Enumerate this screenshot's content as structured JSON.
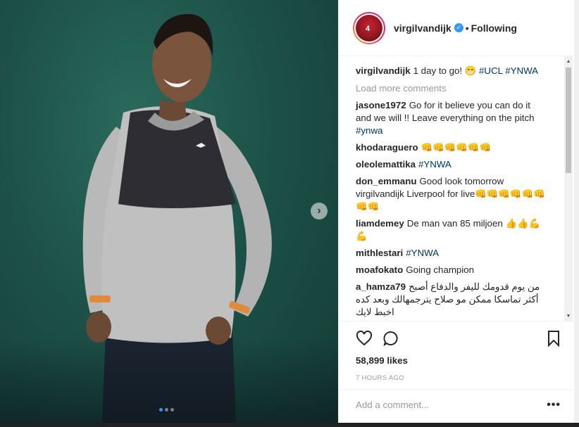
{
  "post": {
    "username": "virgilvandijk",
    "follow_status": "Following",
    "likes": "58,899 likes",
    "time": "7 HOURS AGO",
    "load_more": "Load more comments",
    "add_comment_placeholder": "Add a comment...",
    "carousel": {
      "count": 3,
      "active_index": 0
    }
  },
  "caption": {
    "user": "virgilvandijk",
    "text": "1 day to go! 😁 ",
    "tags": "#UCL #YNWA"
  },
  "comments": [
    {
      "user": "jasone1972",
      "text": "Go for it believe you can do it and we will !! Leave everything on the pitch ",
      "tag": "#ynwa"
    },
    {
      "user": "khodaraguero",
      "text": "👊👊👊👊👊👊",
      "tag": ""
    },
    {
      "user": "oleolemattika",
      "text": "",
      "tag": "#YNWA"
    },
    {
      "user": "don_emmanu",
      "text": "Good look tomorrow virgilvandijk Liverpool for live👊👊👊👊👊👊👊👊",
      "tag": ""
    },
    {
      "user": "liamdemey",
      "text": "De man van 85 miljoen 👍👍💪💪",
      "tag": ""
    },
    {
      "user": "mithlestari",
      "text": "",
      "tag": "#YNWA"
    },
    {
      "user": "moafokato",
      "text": "Going champion",
      "tag": ""
    },
    {
      "user": "a_hamza79",
      "text": "من يوم قدومك لليفر والدفاع أصبح أكثر تماسكا ممكن مو صلاح يترجمهالك وبعد كده اخبط لايك",
      "tag": ""
    }
  ],
  "colors": {
    "accent": "#3897f0",
    "hashtag": "#003569",
    "text": "#262626",
    "muted": "#999999"
  },
  "icons": {
    "like": "heart-icon",
    "comment": "speech-bubble-icon",
    "save": "bookmark-icon",
    "next": "chevron-right-icon",
    "more": "more-dots-icon",
    "verified": "verified-badge-icon"
  }
}
